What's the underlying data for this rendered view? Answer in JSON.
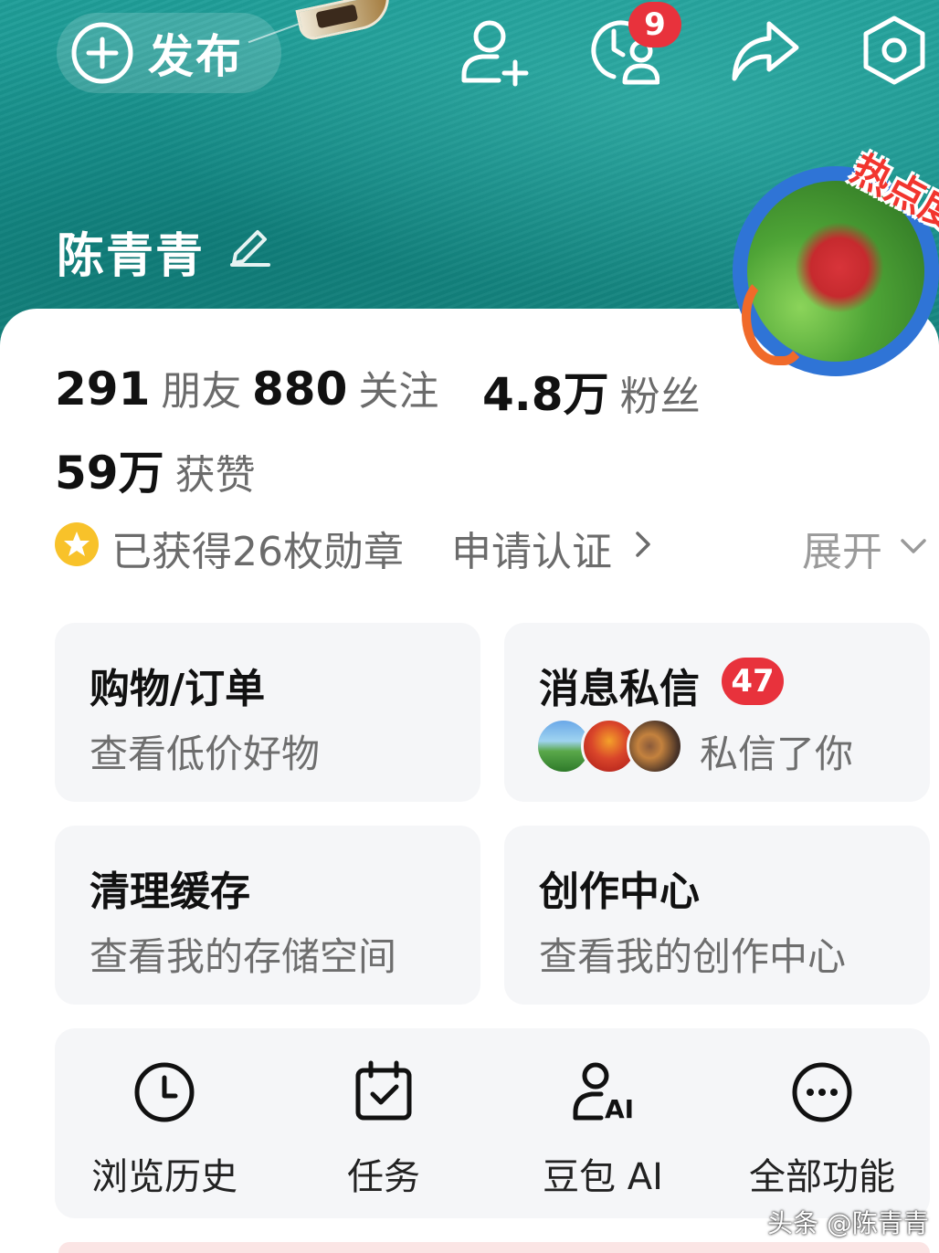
{
  "header": {
    "publish_label": "发布",
    "notification_count": "9",
    "username": "陈青青",
    "hot_frame_label": "热点度"
  },
  "stats": {
    "friends": {
      "value": "291",
      "label": "朋友"
    },
    "following": {
      "value": "880",
      "label": "关注"
    },
    "fans": {
      "value": "4.8万",
      "label": "粉丝"
    },
    "likes": {
      "value": "59万",
      "label": "获赞"
    }
  },
  "medals": {
    "text": "已获得26枚勋章",
    "verify_label": "申请认证",
    "expand_label": "展开"
  },
  "cards": {
    "shopping": {
      "title": "购物/订单",
      "subtitle": "查看低价好物"
    },
    "messages": {
      "title": "消息私信",
      "badge": "47",
      "subtitle": "私信了你"
    },
    "cache": {
      "title": "清理缓存",
      "subtitle": "查看我的存储空间"
    },
    "creator": {
      "title": "创作中心",
      "subtitle": "查看我的创作中心"
    }
  },
  "tools": [
    {
      "label": "浏览历史",
      "icon": "clock-icon"
    },
    {
      "label": "任务",
      "icon": "calendar-check-icon"
    },
    {
      "label": "豆包 AI",
      "icon": "person-ai-icon"
    },
    {
      "label": "全部功能",
      "icon": "more-dots-icon"
    }
  ],
  "watermark": "头条 @陈青青",
  "colors": {
    "accent_red": "#e8323c",
    "sea": "#1a948f",
    "medal_gold": "#f8c22a"
  }
}
